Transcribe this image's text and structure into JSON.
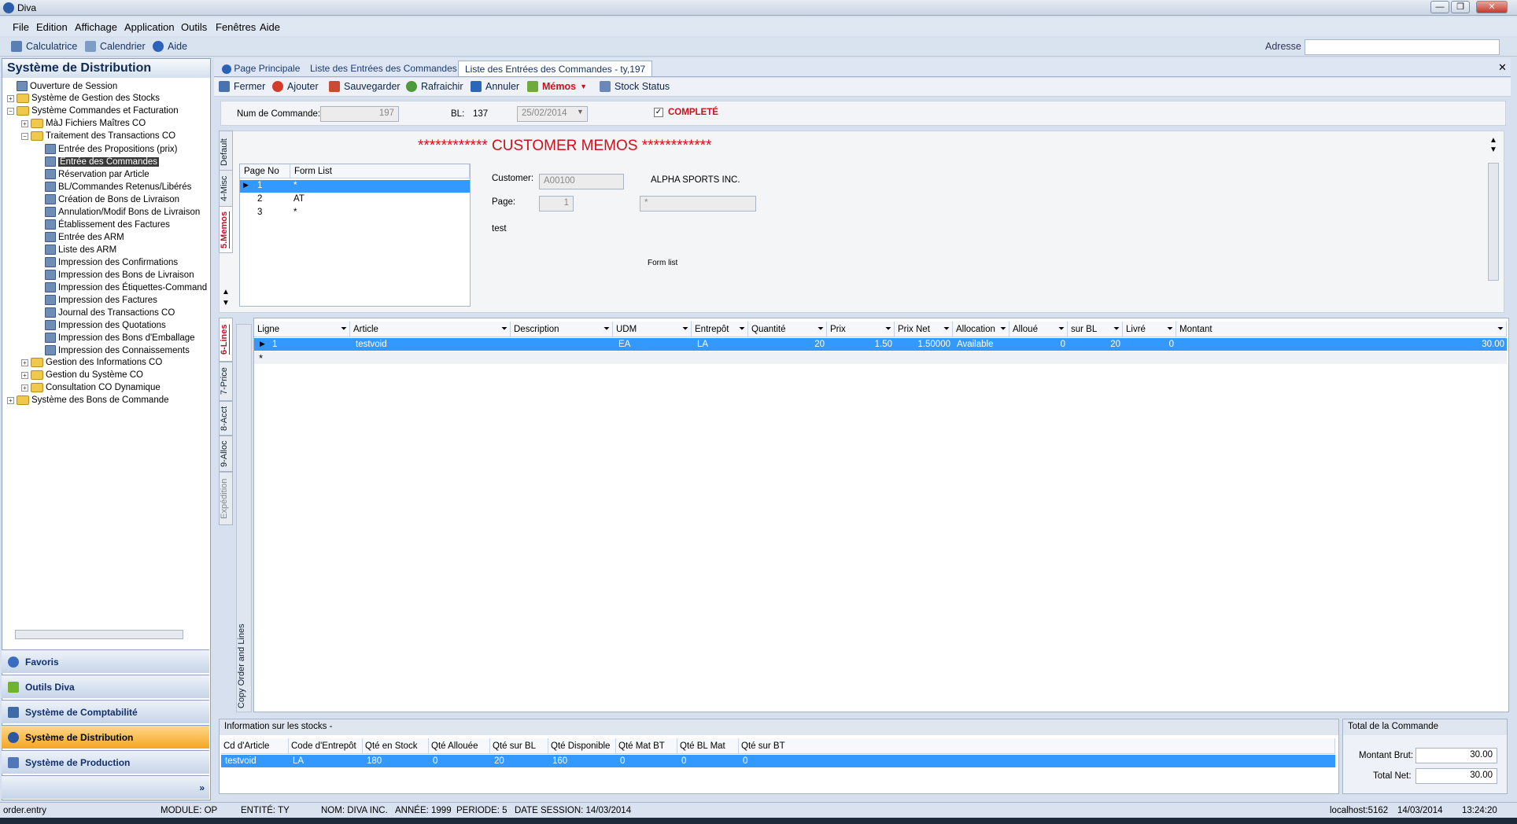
{
  "window": {
    "title": "Diva",
    "buttons": [
      "—",
      "❐",
      "✕"
    ]
  },
  "menubar": [
    "File",
    "Edition",
    "Affichage",
    "Application",
    "Outils",
    "Fenêtres",
    "Aide"
  ],
  "toolbar": {
    "calculator": "Calculatrice",
    "calendar": "Calendrier",
    "help": "Aide",
    "address_label": "Adresse",
    "address_value": ""
  },
  "sidebar": {
    "title": "Système de Distribution",
    "tree": [
      {
        "label": "Ouverture de Session",
        "level": 0,
        "icon": "doc"
      },
      {
        "label": "Système de Gestion des Stocks",
        "level": 0,
        "icon": "folder",
        "exp": "+"
      },
      {
        "label": "Système Commandes et Facturation",
        "level": 0,
        "icon": "folder",
        "exp": "−"
      },
      {
        "label": "MàJ Fichiers Maîtres CO",
        "level": 1,
        "icon": "folder",
        "exp": "+"
      },
      {
        "label": "Traitement des Transactions CO",
        "level": 1,
        "icon": "folder",
        "exp": "−"
      },
      {
        "label": "Entrée des Propositions (prix)",
        "level": 2,
        "icon": "doc"
      },
      {
        "label": "Entrée des Commandes",
        "level": 2,
        "icon": "doc",
        "selected": true
      },
      {
        "label": "Réservation par Article",
        "level": 2,
        "icon": "doc"
      },
      {
        "label": "BL/Commandes Retenus/Libérés",
        "level": 2,
        "icon": "doc"
      },
      {
        "label": "Création de Bons de Livraison",
        "level": 2,
        "icon": "doc"
      },
      {
        "label": "Annulation/Modif Bons de Livraison",
        "level": 2,
        "icon": "doc"
      },
      {
        "label": "Établissement des Factures",
        "level": 2,
        "icon": "doc"
      },
      {
        "label": "Entrée des ARM",
        "level": 2,
        "icon": "doc"
      },
      {
        "label": "Liste des ARM",
        "level": 2,
        "icon": "doc"
      },
      {
        "label": "Impression des Confirmations",
        "level": 2,
        "icon": "doc"
      },
      {
        "label": "Impression des Bons de Livraison",
        "level": 2,
        "icon": "doc"
      },
      {
        "label": "Impression des Étiquettes-Command",
        "level": 2,
        "icon": "doc"
      },
      {
        "label": "Impression des Factures",
        "level": 2,
        "icon": "doc"
      },
      {
        "label": "Journal des Transactions CO",
        "level": 2,
        "icon": "doc"
      },
      {
        "label": "Impression des Quotations",
        "level": 2,
        "icon": "doc"
      },
      {
        "label": "Impression des Bons d'Emballage",
        "level": 2,
        "icon": "doc"
      },
      {
        "label": "Impression des Connaissements",
        "level": 2,
        "icon": "doc"
      },
      {
        "label": "Gestion des Informations CO",
        "level": 1,
        "icon": "folder",
        "exp": "+"
      },
      {
        "label": "Gestion du Système CO",
        "level": 1,
        "icon": "folder",
        "exp": "+"
      },
      {
        "label": "Consultation CO Dynamique",
        "level": 1,
        "icon": "folder",
        "exp": "+"
      },
      {
        "label": "Système des Bons de Commande",
        "level": 0,
        "icon": "folder",
        "exp": "+"
      }
    ],
    "nav": [
      "Favoris",
      "Outils Diva",
      "Système de Comptabilité",
      "Système de Distribution",
      "Système de Production"
    ]
  },
  "tabs": [
    "Page Principale",
    "Liste des Entrées des Commandes",
    "Liste des Entrées des Commandes - ty,197"
  ],
  "actions": [
    "Fermer",
    "Ajouter",
    "Sauvegarder",
    "Rafraichir",
    "Annuler",
    "Mémos",
    "Stock Status"
  ],
  "header": {
    "num_label": "Num de Commande:",
    "num_value": "197",
    "bl_label": "BL:",
    "bl_value": "137",
    "date": "25/02/2014",
    "complete": "COMPLETÉ",
    "check": "✓"
  },
  "memo": {
    "title": "************ CUSTOMER MEMOS ************",
    "vtabs": [
      "Default",
      "4-Misc",
      "5.Memos"
    ],
    "grid_headers": [
      "Page No",
      "Form List"
    ],
    "grid_rows": [
      [
        "1",
        "*"
      ],
      [
        "2",
        "AT"
      ],
      [
        "3",
        "*"
      ]
    ],
    "customer_label": "Customer:",
    "customer_value": "A00100",
    "customer_name": "ALPHA SPORTS INC.",
    "page_label": "Page:",
    "page_value": "1",
    "page_value2": "*",
    "memo_text": "test",
    "form_list_label": "Form list"
  },
  "lines": {
    "vtabs": [
      "6-Lines",
      "7-Price",
      "8-Acct",
      "9-Alloc",
      "Expédition"
    ],
    "copy_label": "Copy Order and Lines",
    "headers": [
      "Ligne",
      "Article",
      "Description",
      "UDM",
      "Entrepôt",
      "Quantité",
      "Prix",
      "Prix Net",
      "Allocation",
      "Alloué",
      "sur BL",
      "Livré",
      "Montant"
    ],
    "row": [
      "1",
      "testvoid",
      "",
      "EA",
      "LA",
      "20",
      "1.50",
      "1.50000",
      "Available",
      "0",
      "20",
      "0",
      "30.00"
    ],
    "new_marker": "*"
  },
  "stock": {
    "title": "Information sur les stocks -",
    "headers": [
      "Cd d'Article",
      "Code d'Entrepôt",
      "Qté en Stock",
      "Qté Allouée",
      "Qté sur BL",
      "Qté Disponible",
      "Qté Mat BT",
      "Qté BL Mat",
      "Qté sur BT"
    ],
    "row": [
      "testvoid",
      "LA",
      "180",
      "0",
      "20",
      "160",
      "0",
      "0",
      "0"
    ]
  },
  "totals": {
    "title": "Total de la Commande",
    "gross_label": "Montant Brut:",
    "gross": "30.00",
    "net_label": "Total Net:",
    "net": "30.00"
  },
  "status": {
    "program": "order.entry",
    "module": "MODULE: OP",
    "entity": "ENTITÉ: TY",
    "name": "NOM: DIVA INC.",
    "year": "ANNÉE: 1999",
    "period": "PERIODE: 5",
    "session": "DATE SESSION: 14/03/2014",
    "host": "localhost:5162",
    "date": "14/03/2014",
    "time": "13:24:20"
  },
  "colors": {
    "accent": "#3399ff",
    "memo_red": "#d0101a",
    "active_nav": "#f5a623"
  }
}
